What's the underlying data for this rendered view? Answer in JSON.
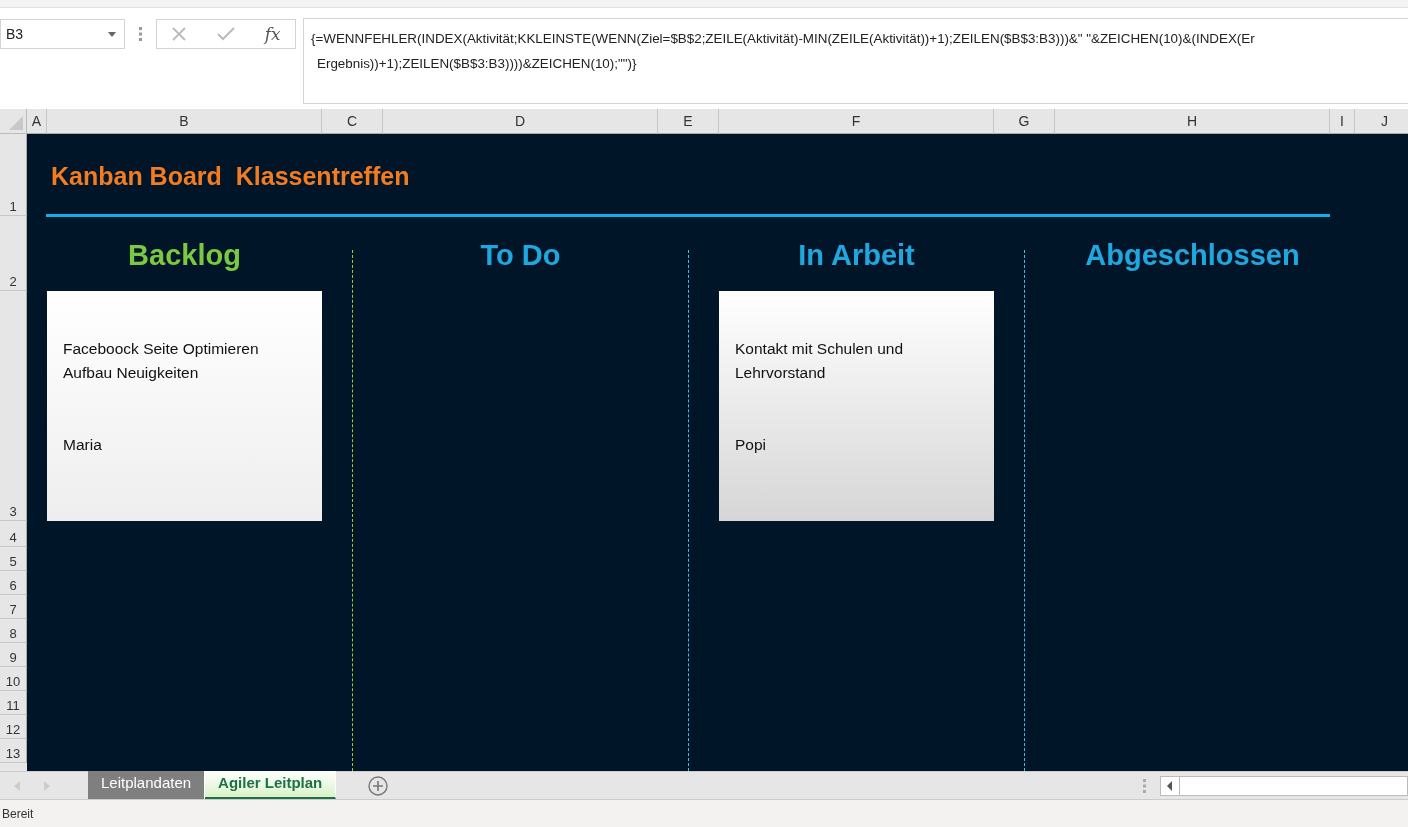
{
  "name_box": "B3",
  "formula_bar": {
    "fx": "fx",
    "lines": [
      "{=WENNFEHLER(INDEX(Aktivität;KKLEINSTE(WENN(Ziel=$B$2;ZEILE(Aktivität)-MIN(ZEILE(Aktivität))+1);ZEILEN($B$3:B3)))&\" \"&ZEICHEN(10)&(INDEX(Er",
      "Ergebnis))+1);ZEILEN($B$3:B3))))&ZEICHEN(10);\"\")}"
    ]
  },
  "column_headers": [
    "A",
    "B",
    "C",
    "D",
    "E",
    "F",
    "G",
    "H",
    "I",
    "J"
  ],
  "row_headers": [
    "1",
    "2",
    "3",
    "4",
    "5",
    "6",
    "7",
    "8",
    "9",
    "10",
    "11",
    "12",
    "13"
  ],
  "board": {
    "title": "Kanban Board  Klassentreffen",
    "lanes": [
      {
        "title": "Backlog",
        "color": "#7ac943",
        "cards": [
          {
            "task": [
              "Faceboock Seite Optimieren",
              "Aufbau Neuigkeiten"
            ],
            "owner": "Maria"
          }
        ]
      },
      {
        "title": "To Do",
        "color": "#1fa8e0"
      },
      {
        "title": "In Arbeit",
        "color": "#1fa8e0",
        "cards": [
          {
            "task": [
              "Kontakt mit Schulen und",
              "Lehrvorstand"
            ],
            "owner": "Popi"
          }
        ]
      },
      {
        "title": "Abgeschlossen",
        "color": "#1fa8e0"
      }
    ],
    "dividers": [
      {
        "color": "#9acd32"
      },
      {
        "color": "#4fb8e0"
      },
      {
        "color": "#4fb8e0"
      }
    ]
  },
  "sheet_tabs": [
    {
      "label": "Leitplandaten",
      "selected": false
    },
    {
      "label": "Agiler Leitplan",
      "selected": true
    }
  ],
  "status_bar": "Bereit"
}
